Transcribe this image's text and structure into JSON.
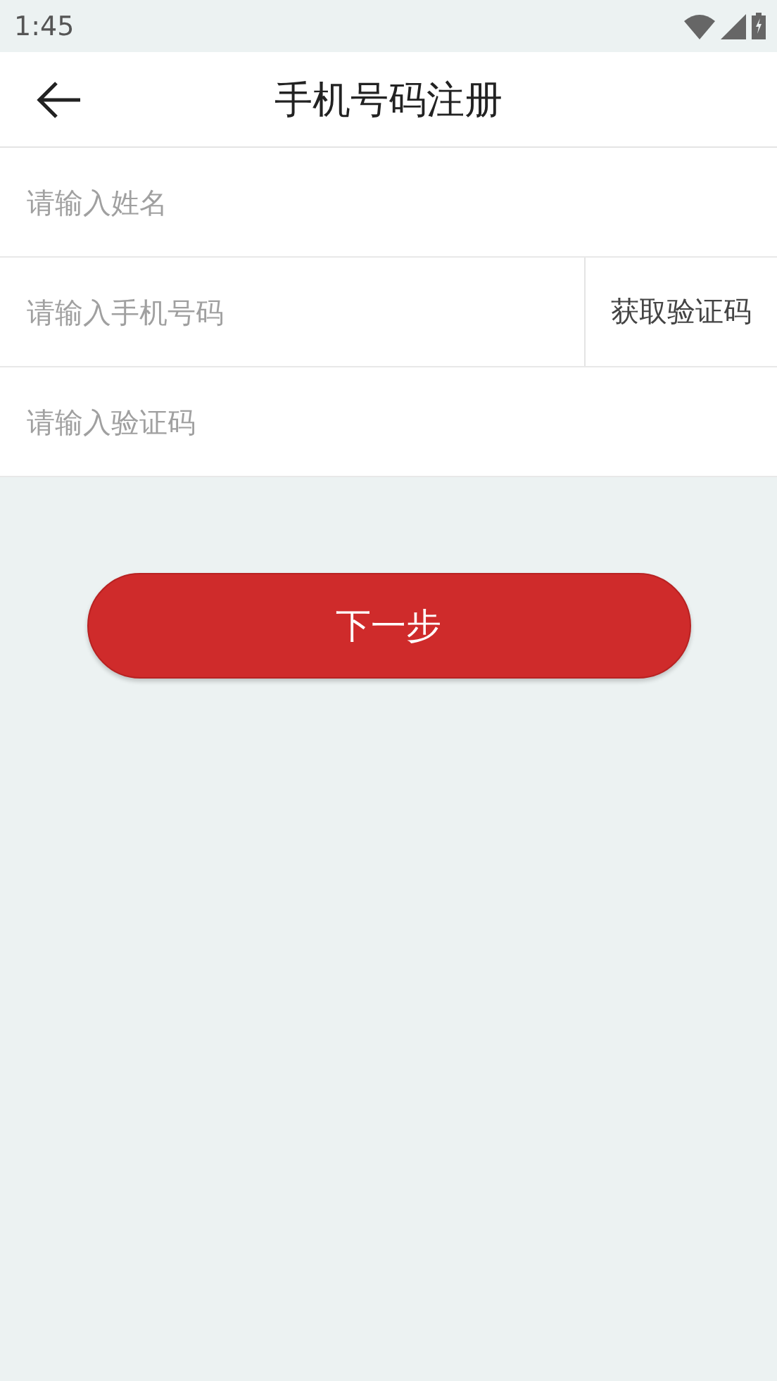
{
  "status_bar": {
    "time": "1:45"
  },
  "header": {
    "title": "手机号码注册"
  },
  "fields": [
    {
      "kind": "plain",
      "placeholder": "请输入姓名"
    },
    {
      "kind": "with_button",
      "placeholder": "请输入手机号码",
      "button": "获取验证码"
    },
    {
      "kind": "plain",
      "placeholder": "请输入验证码"
    }
  ],
  "next_button": "下一步"
}
